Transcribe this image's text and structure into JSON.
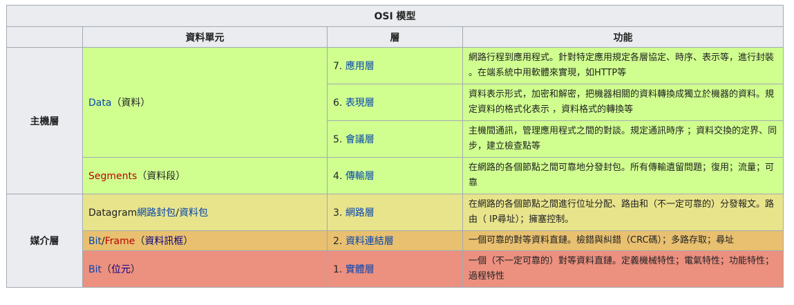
{
  "title": "OSI 模型",
  "headers": {
    "unit": "資料單元",
    "layer": "層",
    "function": "功能"
  },
  "groups": {
    "host": "主機層",
    "media": "媒介層"
  },
  "units": {
    "data_link": "Data",
    "data_rest": "（資料）",
    "segments_link": "Segments",
    "segments_rest": "（資料段）",
    "datagram_plain": "Datagram",
    "datagram_link1": "網路封包",
    "datagram_slash": "/",
    "datagram_link2": "資料包",
    "bit_link": "Bit",
    "bit_slash": "/",
    "frame_link": "Frame",
    "frame_p1": "（",
    "frame_link2": "資料訊框",
    "frame_p2": "）",
    "bit2_link": "Bit",
    "bit2_p1": "（",
    "bit2_link2": "位元",
    "bit2_p2": "）"
  },
  "layers": [
    {
      "num": "7. ",
      "name": "應用層",
      "func": "網路行程到應用程式。針對特定應用規定各層協定、時序、表示等，進行封裝 。在端系統中用軟體來實現，如HTTP等"
    },
    {
      "num": "6. ",
      "name": "表現層",
      "func": "資料表示形式，加密和解密，把機器相關的資料轉換成獨立於機器的資料。規定資料的格式化表示 ，資料格式的轉換等"
    },
    {
      "num": "5. ",
      "name": "會議層",
      "func": "主機間通訊，管理應用程式之間的對談。規定通訊時序 ；資料交換的定界、同步，建立檢查點等"
    },
    {
      "num": "4. ",
      "name": "傳輸層",
      "func": "在網路的各個節點之間可靠地分發封包。所有傳輸遺留問題；復用；流量；可靠"
    },
    {
      "num": "3. ",
      "name": "網路層",
      "func": "在網路的各個節點之間進行位址分配、路由和（不一定可靠的）分發報文。路由（ IP尋址）；擁塞控制。"
    },
    {
      "num": "2. ",
      "name": "資料連結層",
      "func": "一個可靠的對等資料直鏈。檢錯與糾錯（CRC碼）；多路存取；尋址"
    },
    {
      "num": "1. ",
      "name": "實體層",
      "func": "一個（不一定可靠的）對等資料直鏈。定義機械特性；電氣特性；功能特性；過程特性"
    }
  ],
  "colors": {
    "green": "#d0ff90",
    "yellow": "#e8e48c",
    "orange": "#e8c070",
    "red": "#ec9080",
    "header": "#eaecf0",
    "border": "#a2a9b1"
  }
}
